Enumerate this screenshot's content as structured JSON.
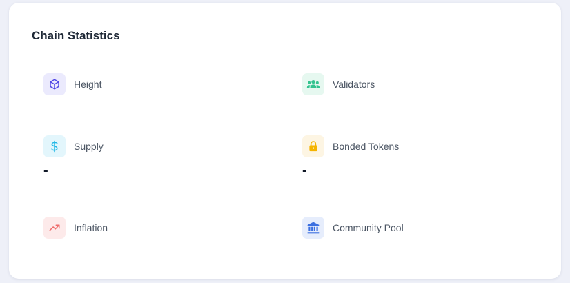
{
  "card": {
    "title": "Chain Statistics"
  },
  "stats": {
    "height": {
      "label": "Height",
      "value": "",
      "icon": "cube-icon",
      "icon_color": "#4f46e5",
      "icon_bg": "#ebeafd"
    },
    "validators": {
      "label": "Validators",
      "value": "",
      "icon": "users-group-icon",
      "icon_color": "#34c38f",
      "icon_bg": "#e6f8f0"
    },
    "supply": {
      "label": "Supply",
      "value": "-",
      "icon": "dollar-icon",
      "icon_color": "#22b8e6",
      "icon_bg": "#e3f6fc"
    },
    "bonded": {
      "label": "Bonded Tokens",
      "value": "-",
      "icon": "lock-icon",
      "icon_color": "#f5b400",
      "icon_bg": "#fdf5e3"
    },
    "inflation": {
      "label": "Inflation",
      "value": "",
      "icon": "trending-up-icon",
      "icon_color": "#ef6b6b",
      "icon_bg": "#fdeaea"
    },
    "pool": {
      "label": "Community Pool",
      "value": "",
      "icon": "bank-icon",
      "icon_color": "#3b6fe0",
      "icon_bg": "#e6edfc"
    }
  }
}
